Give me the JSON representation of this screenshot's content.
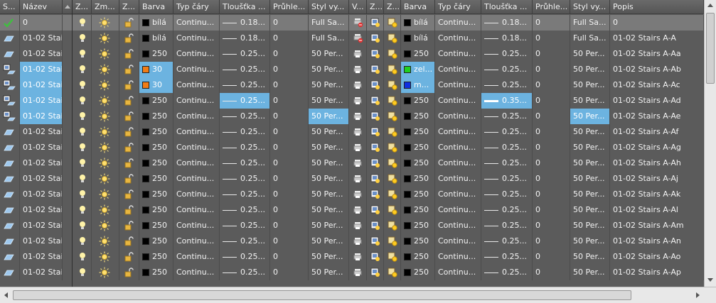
{
  "headers": [
    "S...",
    "Název",
    "",
    "Z...",
    "Zm...",
    "Z...",
    "Barva",
    "Typ čáry",
    "Tloušťka ...",
    "Průhle...",
    "Styl vy...",
    "V...",
    "Z...",
    "Z...",
    "Barva",
    "Typ čáry",
    "Tloušťka ...",
    "Průhle...",
    "Styl vy...",
    "Popis"
  ],
  "rows": [
    {
      "icon": "check",
      "name": "0",
      "color": "bílá",
      "color_hex": "#000000",
      "ltype": "Continu...",
      "lw": "0.18...",
      "tr": "0",
      "style": "Full Sa...",
      "plot": "no-plot",
      "vp_color": "bílá",
      "vp_hex": "#000000",
      "vp_ltype": "Continu...",
      "vp_lw": "0.18...",
      "vp_tr": "0",
      "vp_style": "Full Sa...",
      "desc": "0",
      "current": true
    },
    {
      "icon": "layer",
      "name": "01-02 Stair...",
      "color": "bílá",
      "color_hex": "#000000",
      "ltype": "Continu...",
      "lw": "0.18...",
      "tr": "0",
      "style": "Full Sa...",
      "plot": "no-plot",
      "vp_color": "bílá",
      "vp_hex": "#000000",
      "vp_ltype": "Continu...",
      "vp_lw": "0.18...",
      "vp_tr": "0",
      "vp_style": "Full Sa...",
      "desc": "01-02 Stairs A-A"
    },
    {
      "icon": "layer",
      "name": "01-02 Stair...",
      "color": "250",
      "color_hex": "#000000",
      "ltype": "Continu...",
      "lw": "0.25...",
      "tr": "0",
      "style": "50 Per...",
      "plot": "plot",
      "vp_color": "250",
      "vp_hex": "#000000",
      "vp_ltype": "Continu...",
      "vp_lw": "0.25...",
      "vp_tr": "0",
      "vp_style": "50 Per...",
      "desc": "01-02 Stairs A-Aa"
    },
    {
      "icon": "layer-vp",
      "name": "01-02 Stair...",
      "name_sel": true,
      "color": "30",
      "color_hex": "#f07c16",
      "color_sel": true,
      "ltype": "Continu...",
      "lw": "0.25...",
      "tr": "0",
      "style": "50 Per...",
      "plot": "plot",
      "vp_color": "zel...",
      "vp_hex": "#20d020",
      "vp_sel": true,
      "vp_ltype": "Continu...",
      "vp_lw": "0.25...",
      "vp_tr": "0",
      "vp_style": "50 Per...",
      "desc": "01-02 Stairs A-Ab"
    },
    {
      "icon": "layer-vp",
      "name": "01-02 Stair...",
      "name_sel": true,
      "color": "30",
      "color_hex": "#f07c16",
      "color_sel": true,
      "ltype": "Continu...",
      "lw": "0.25...",
      "tr": "0",
      "style": "50 Per...",
      "plot": "plot",
      "vp_color": "m...",
      "vp_hex": "#1030e0",
      "vp_sel": true,
      "vp_ltype": "Continu...",
      "vp_lw": "0.25...",
      "vp_tr": "0",
      "vp_style": "50 Per...",
      "desc": "01-02 Stairs A-Ac"
    },
    {
      "icon": "layer-vp",
      "name": "01-02 Stair...",
      "name_sel": true,
      "color": "250",
      "color_hex": "#000000",
      "ltype": "Continu...",
      "lw": "0.25...",
      "lw_sel": true,
      "tr": "0",
      "style": "50 Per...",
      "plot": "plot",
      "vp_color": "250",
      "vp_hex": "#000000",
      "vp_ltype": "Continu...",
      "vp_lw": "0.35...",
      "vp_lw_sel": true,
      "vp_lw_thick": true,
      "vp_tr": "0",
      "vp_style": "50 Per...",
      "desc": "01-02 Stairs A-Ad"
    },
    {
      "icon": "layer-vp",
      "name": "01-02 Stair...",
      "name_sel": true,
      "color": "250",
      "color_hex": "#000000",
      "ltype": "Continu...",
      "lw": "0.25...",
      "tr": "0",
      "style": "50 Per...",
      "style_sel": true,
      "plot": "plot",
      "vp_color": "250",
      "vp_hex": "#000000",
      "vp_ltype": "Continu...",
      "vp_lw": "0.25...",
      "vp_tr": "0",
      "vp_style": "50 Per...",
      "vp_style_sel": true,
      "desc": "01-02 Stairs A-Ae"
    },
    {
      "icon": "layer",
      "name": "01-02 Stair...",
      "color": "250",
      "color_hex": "#000000",
      "ltype": "Continu...",
      "lw": "0.25...",
      "tr": "0",
      "style": "50 Per...",
      "plot": "plot",
      "vp_color": "250",
      "vp_hex": "#000000",
      "vp_ltype": "Continu...",
      "vp_lw": "0.25...",
      "vp_tr": "0",
      "vp_style": "50 Per...",
      "desc": "01-02 Stairs A-Af"
    },
    {
      "icon": "layer",
      "name": "01-02 Stair...",
      "color": "250",
      "color_hex": "#000000",
      "ltype": "Continu...",
      "lw": "0.25...",
      "tr": "0",
      "style": "50 Per...",
      "plot": "plot",
      "vp_color": "250",
      "vp_hex": "#000000",
      "vp_ltype": "Continu...",
      "vp_lw": "0.25...",
      "vp_tr": "0",
      "vp_style": "50 Per...",
      "desc": "01-02 Stairs A-Ag"
    },
    {
      "icon": "layer",
      "name": "01-02 Stair...",
      "color": "250",
      "color_hex": "#000000",
      "ltype": "Continu...",
      "lw": "0.25...",
      "tr": "0",
      "style": "50 Per...",
      "plot": "plot",
      "vp_color": "250",
      "vp_hex": "#000000",
      "vp_ltype": "Continu...",
      "vp_lw": "0.25...",
      "vp_tr": "0",
      "vp_style": "50 Per...",
      "desc": "01-02 Stairs A-Ah"
    },
    {
      "icon": "layer",
      "name": "01-02 Stair...",
      "color": "250",
      "color_hex": "#000000",
      "ltype": "Continu...",
      "lw": "0.25...",
      "tr": "0",
      "style": "50 Per...",
      "plot": "plot",
      "vp_color": "250",
      "vp_hex": "#000000",
      "vp_ltype": "Continu...",
      "vp_lw": "0.25...",
      "vp_tr": "0",
      "vp_style": "50 Per...",
      "desc": "01-02 Stairs A-Aj"
    },
    {
      "icon": "layer",
      "name": "01-02 Stair...",
      "color": "250",
      "color_hex": "#000000",
      "ltype": "Continu...",
      "lw": "0.25...",
      "tr": "0",
      "style": "50 Per...",
      "plot": "plot",
      "vp_color": "250",
      "vp_hex": "#000000",
      "vp_ltype": "Continu...",
      "vp_lw": "0.25...",
      "vp_tr": "0",
      "vp_style": "50 Per...",
      "desc": "01-02 Stairs A-Ak"
    },
    {
      "icon": "layer",
      "name": "01-02 Stair...",
      "color": "250",
      "color_hex": "#000000",
      "ltype": "Continu...",
      "lw": "0.25...",
      "tr": "0",
      "style": "50 Per...",
      "plot": "plot",
      "vp_color": "250",
      "vp_hex": "#000000",
      "vp_ltype": "Continu...",
      "vp_lw": "0.25...",
      "vp_tr": "0",
      "vp_style": "50 Per...",
      "desc": "01-02 Stairs A-Al"
    },
    {
      "icon": "layer",
      "name": "01-02 Stair...",
      "color": "250",
      "color_hex": "#000000",
      "ltype": "Continu...",
      "lw": "0.25...",
      "tr": "0",
      "style": "50 Per...",
      "plot": "plot",
      "vp_color": "250",
      "vp_hex": "#000000",
      "vp_ltype": "Continu...",
      "vp_lw": "0.25...",
      "vp_tr": "0",
      "vp_style": "50 Per...",
      "desc": "01-02 Stairs A-Am"
    },
    {
      "icon": "layer",
      "name": "01-02 Stair...",
      "color": "250",
      "color_hex": "#000000",
      "ltype": "Continu...",
      "lw": "0.25...",
      "tr": "0",
      "style": "50 Per...",
      "plot": "plot",
      "vp_color": "250",
      "vp_hex": "#000000",
      "vp_ltype": "Continu...",
      "vp_lw": "0.25...",
      "vp_tr": "0",
      "vp_style": "50 Per...",
      "desc": "01-02 Stairs A-An"
    },
    {
      "icon": "layer",
      "name": "01-02 Stair...",
      "color": "250",
      "color_hex": "#000000",
      "ltype": "Continu...",
      "lw": "0.25...",
      "tr": "0",
      "style": "50 Per...",
      "plot": "plot",
      "vp_color": "250",
      "vp_hex": "#000000",
      "vp_ltype": "Continu...",
      "vp_lw": "0.25...",
      "vp_tr": "0",
      "vp_style": "50 Per...",
      "desc": "01-02 Stairs A-Ao"
    },
    {
      "icon": "layer",
      "name": "01-02 Stair...",
      "color": "250",
      "color_hex": "#000000",
      "ltype": "Continu...",
      "lw": "0.25...",
      "tr": "0",
      "style": "50 Per...",
      "plot": "plot",
      "vp_color": "250",
      "vp_hex": "#000000",
      "vp_ltype": "Continu...",
      "vp_lw": "0.25...",
      "vp_tr": "0",
      "vp_style": "50 Per...",
      "desc": "01-02 Stairs A-Ap"
    }
  ]
}
